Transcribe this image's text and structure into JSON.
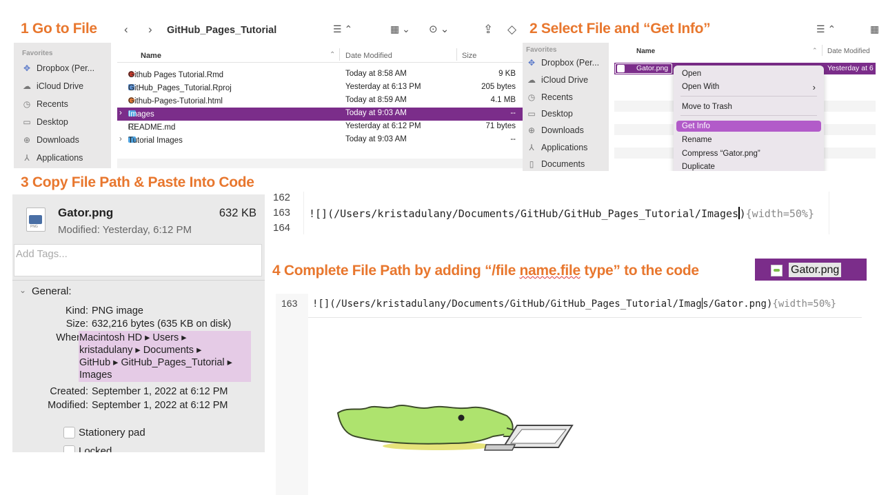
{
  "steps": {
    "s1": "1 Go to File",
    "s2": "2 Select File and “Get Info”",
    "s3": "3 Copy File Path & Paste Into Code",
    "s4_pre": "4 Complete File Path by adding “/file ",
    "s4_underline": "name.file",
    "s4_post": " type” to the code"
  },
  "finder": {
    "title": "GitHub_Pages_Tutorial",
    "favorites_label": "Favorites",
    "sidebar": [
      {
        "icon": "dropbox-icon",
        "label": "Dropbox (Per..."
      },
      {
        "icon": "cloud-icon",
        "label": "iCloud Drive"
      },
      {
        "icon": "clock-icon",
        "label": "Recents"
      },
      {
        "icon": "desktop-icon",
        "label": "Desktop"
      },
      {
        "icon": "download-icon",
        "label": "Downloads"
      },
      {
        "icon": "applications-icon",
        "label": "Applications"
      }
    ],
    "columns": {
      "name": "Name",
      "date": "Date Modified",
      "size": "Size"
    },
    "files": [
      {
        "name": "Github Pages Tutorial.Rmd",
        "date": "Today at 8:58 AM",
        "size": "9 KB",
        "icon": "rmd-file-icon",
        "color": "#c0392b"
      },
      {
        "name": "GitHub_Pages_Tutorial.Rproj",
        "date": "Yesterday at 6:13 PM",
        "size": "205 bytes",
        "icon": "rproj-file-icon",
        "color": "#5b8fd0"
      },
      {
        "name": "Github-Pages-Tutorial.html",
        "date": "Today at 8:59 AM",
        "size": "4.1 MB",
        "icon": "html-file-icon",
        "color": "#e07b39"
      },
      {
        "name": "Images",
        "date": "Today at 9:03 AM",
        "size": "--",
        "icon": "folder-icon",
        "color": "#4fa3e0"
      },
      {
        "name": "README.md",
        "date": "Yesterday at 6:12 PM",
        "size": "71 bytes",
        "icon": "md-file-icon",
        "color": "#7d7d7d"
      },
      {
        "name": "Tutorial Images",
        "date": "Today at 9:03 AM",
        "size": "--",
        "icon": "folder-icon",
        "color": "#4fa3e0"
      }
    ]
  },
  "finder2": {
    "favorites_label": "Favorites",
    "sidebar": [
      {
        "icon": "dropbox-icon",
        "label": "Dropbox (Per..."
      },
      {
        "icon": "cloud-icon",
        "label": "iCloud Drive"
      },
      {
        "icon": "clock-icon",
        "label": "Recents"
      },
      {
        "icon": "desktop-icon",
        "label": "Desktop"
      },
      {
        "icon": "download-icon",
        "label": "Downloads"
      },
      {
        "icon": "applications-icon",
        "label": "Applications"
      },
      {
        "icon": "documents-icon",
        "label": "Documents"
      }
    ],
    "col_name": "Name",
    "col_date": "Date Modified",
    "selected_file": "Gator.png",
    "selected_date": "Yesterday at 6",
    "menu": [
      "Open",
      "Open With",
      "Move to Trash",
      "Get Info",
      "Rename",
      "Compress “Gator.png”",
      "Duplicate"
    ]
  },
  "info": {
    "filename": "Gator.png",
    "size": "632 KB",
    "modified": "Modified: Yesterday, 6:12 PM",
    "tags_placeholder": "Add Tags...",
    "general": "General:",
    "kind_label": "Kind:",
    "kind": "PNG image",
    "size_label": "Size:",
    "size_full": "632,216 bytes (635 KB on disk)",
    "where_label": "Where:",
    "where": [
      "Macintosh HD ▸ Users ▸",
      "kristadulany ▸ Documents ▸",
      "GitHub ▸ GitHub_Pages_Tutorial ▸",
      "Images"
    ],
    "created_label": "Created:",
    "created": "September 1, 2022 at 6:12 PM",
    "modified_label": "Modified:",
    "modified_full": "September 1, 2022 at 6:12 PM",
    "stationery": "Stationery pad",
    "locked": "Locked",
    "file_badge": "PNG"
  },
  "code1": {
    "line_prev": "162",
    "line": "163",
    "line_next": "164",
    "text": "![](/Users/kristadulany/Documents/GitHub/GitHub_Pages_Tutorial/Images",
    "after_cursor": ")",
    "tail": "{width=50%}"
  },
  "code2": {
    "line": "163",
    "text_before": "![](/Users/kristadulany/Documents/GitHub/GitHub_Pages_Tutorial/Imag",
    "text_after": "s/Gator.png)",
    "tail": "{width=50%}"
  },
  "chip": {
    "label": "Gator.png"
  }
}
